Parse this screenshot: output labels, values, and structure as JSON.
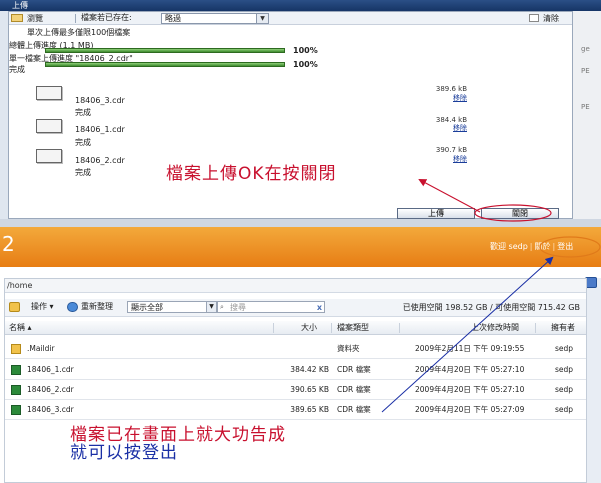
{
  "upload_dialog": {
    "title": "上傳",
    "toolbar": {
      "browse_label": "瀏覽",
      "exist_label": "檔案若已存在:",
      "exist_select_value": "略過",
      "clear_label": "清除"
    },
    "limit_text": "單次上傳最多僅限100個檔案",
    "total_progress_label": "總體上傳進度 (1.1 MB)",
    "total_progress_pct": 100,
    "total_progress_pct_text": "100%",
    "file_progress_label": "單一檔案上傳進度 \"18406_2.cdr\"",
    "file_progress_pct": 100,
    "file_progress_pct_text": "100%",
    "status_done": "完成",
    "files": [
      {
        "name": "18406_3.cdr",
        "status": "完成",
        "size": "389.6 kB",
        "remove": "移除"
      },
      {
        "name": "18406_1.cdr",
        "status": "完成",
        "size": "384.4 kB",
        "remove": "移除"
      },
      {
        "name": "18406_2.cdr",
        "status": "完成",
        "size": "390.7 kB",
        "remove": "移除"
      }
    ],
    "upload_button": "上傳",
    "close_button": "關閉"
  },
  "annotation_top": "檔案上傳OK在按關閉",
  "right_strip": {
    "a": "ge",
    "b": "PE",
    "c": "PE"
  },
  "header": {
    "logo_fragment": "2",
    "welcome": "歡迎 sedp",
    "about": "關於",
    "logout": "登出"
  },
  "file_panel": {
    "path": "/home",
    "ops": {
      "actions_label": "操作",
      "refresh_label": "重新整理",
      "filter_value": "顯示全部",
      "search_placeholder": "搜尋",
      "clear_symbol": "x",
      "quota_text": "已使用空間 198.52 GB / 可使用空間 715.42 GB"
    },
    "columns": {
      "name": "名稱",
      "size": "大小",
      "type": "檔案類型",
      "modified": "上次修改時間",
      "owner": "擁有者"
    },
    "rows": [
      {
        "name": ".Maildir",
        "size": "",
        "type": "資料夾",
        "modified": "2009年2月11日 下午 09:19:55",
        "owner": "sedp",
        "icon": "folder-icon"
      },
      {
        "name": "18406_1.cdr",
        "size": "384.42 KB",
        "type": "CDR 檔案",
        "modified": "2009年4月20日 下午 05:27:10",
        "owner": "sedp",
        "icon": "cdr-file-icon"
      },
      {
        "name": "18406_2.cdr",
        "size": "390.65 KB",
        "type": "CDR 檔案",
        "modified": "2009年4月20日 下午 05:27:10",
        "owner": "sedp",
        "icon": "cdr-file-icon"
      },
      {
        "name": "18406_3.cdr",
        "size": "389.65 KB",
        "type": "CDR 檔案",
        "modified": "2009年4月20日 下午 05:27:09",
        "owner": "sedp",
        "icon": "cdr-file-icon"
      }
    ]
  },
  "annotation_bottom": {
    "line1": "檔案已在畫面上就大功告成",
    "line2": "就可以按登出"
  },
  "colors": {
    "annotation_red": "#c8102e",
    "annotation_blue": "#1a2fa5",
    "header_orange": "#e77d14",
    "progress_green": "#3d8a2e"
  }
}
